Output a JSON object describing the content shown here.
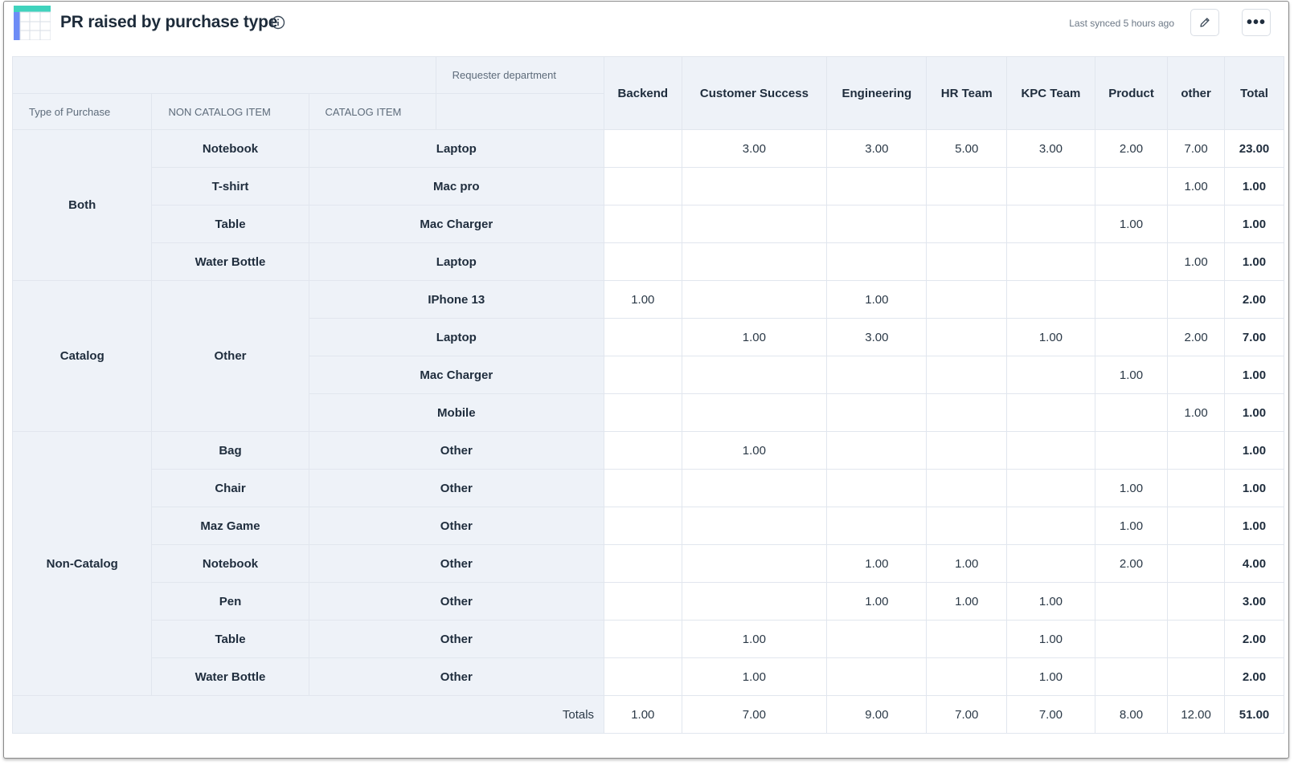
{
  "header": {
    "title": "PR raised by purchase type",
    "sync_text": "Last synced 5 hours ago",
    "icons": {
      "app": "table-icon",
      "info": "info-icon",
      "edit": "pencil-icon",
      "more": "ellipsis-icon"
    },
    "more_label": "•••"
  },
  "colors": {
    "accent_teal": "#3fd3bd",
    "accent_blue": "#6d8cf6",
    "header_bg": "#eef2f8",
    "border": "#e1e6ee"
  },
  "table": {
    "requester_department_label": "Requester department",
    "row_headers": [
      "Type of Purchase",
      "NON CATALOG ITEM",
      "CATALOG ITEM"
    ],
    "columns": [
      "Backend",
      "Customer Success",
      "Engineering",
      "HR Team",
      "KPC Team",
      "Product",
      "other",
      "Total"
    ],
    "groups": [
      {
        "type": "Both",
        "rows": [
          {
            "non_catalog": "Notebook",
            "catalog": "Laptop",
            "values": [
              "",
              "3.00",
              "3.00",
              "5.00",
              "3.00",
              "2.00",
              "7.00",
              "23.00"
            ]
          },
          {
            "non_catalog": "T-shirt",
            "catalog": "Mac pro",
            "values": [
              "",
              "",
              "",
              "",
              "",
              "",
              "1.00",
              "1.00"
            ]
          },
          {
            "non_catalog": "Table",
            "catalog": "Mac Charger",
            "values": [
              "",
              "",
              "",
              "",
              "",
              "1.00",
              "",
              "1.00"
            ]
          },
          {
            "non_catalog": "Water Bottle",
            "catalog": "Laptop",
            "values": [
              "",
              "",
              "",
              "",
              "",
              "",
              "1.00",
              "1.00"
            ]
          }
        ]
      },
      {
        "type": "Catalog",
        "rows": [
          {
            "non_catalog": "Other",
            "catalog": "IPhone 13",
            "values": [
              "1.00",
              "",
              "1.00",
              "",
              "",
              "",
              "",
              "2.00"
            ]
          },
          {
            "non_catalog": "Other",
            "catalog": "Laptop",
            "values": [
              "",
              "1.00",
              "3.00",
              "",
              "1.00",
              "",
              "2.00",
              "7.00"
            ]
          },
          {
            "non_catalog": "Other",
            "catalog": "Mac Charger",
            "values": [
              "",
              "",
              "",
              "",
              "",
              "1.00",
              "",
              "1.00"
            ]
          },
          {
            "non_catalog": "Other",
            "catalog": "Mobile",
            "values": [
              "",
              "",
              "",
              "",
              "",
              "",
              "1.00",
              "1.00"
            ]
          }
        ]
      },
      {
        "type": "Non-Catalog",
        "rows": [
          {
            "non_catalog": "Bag",
            "catalog": "Other",
            "values": [
              "",
              "1.00",
              "",
              "",
              "",
              "",
              "",
              "1.00"
            ]
          },
          {
            "non_catalog": "Chair",
            "catalog": "Other",
            "values": [
              "",
              "",
              "",
              "",
              "",
              "1.00",
              "",
              "1.00"
            ]
          },
          {
            "non_catalog": "Maz Game",
            "catalog": "Other",
            "values": [
              "",
              "",
              "",
              "",
              "",
              "1.00",
              "",
              "1.00"
            ]
          },
          {
            "non_catalog": "Notebook",
            "catalog": "Other",
            "values": [
              "",
              "",
              "1.00",
              "1.00",
              "",
              "2.00",
              "",
              "4.00"
            ]
          },
          {
            "non_catalog": "Pen",
            "catalog": "Other",
            "values": [
              "",
              "",
              "1.00",
              "1.00",
              "1.00",
              "",
              "",
              "3.00"
            ]
          },
          {
            "non_catalog": "Table",
            "catalog": "Other",
            "values": [
              "",
              "1.00",
              "",
              "",
              "1.00",
              "",
              "",
              "2.00"
            ]
          },
          {
            "non_catalog": "Water Bottle",
            "catalog": "Other",
            "values": [
              "",
              "1.00",
              "",
              "",
              "1.00",
              "",
              "",
              "2.00"
            ]
          }
        ]
      }
    ],
    "totals_label": "Totals",
    "totals": [
      "1.00",
      "7.00",
      "9.00",
      "7.00",
      "7.00",
      "8.00",
      "12.00",
      "51.00"
    ]
  }
}
